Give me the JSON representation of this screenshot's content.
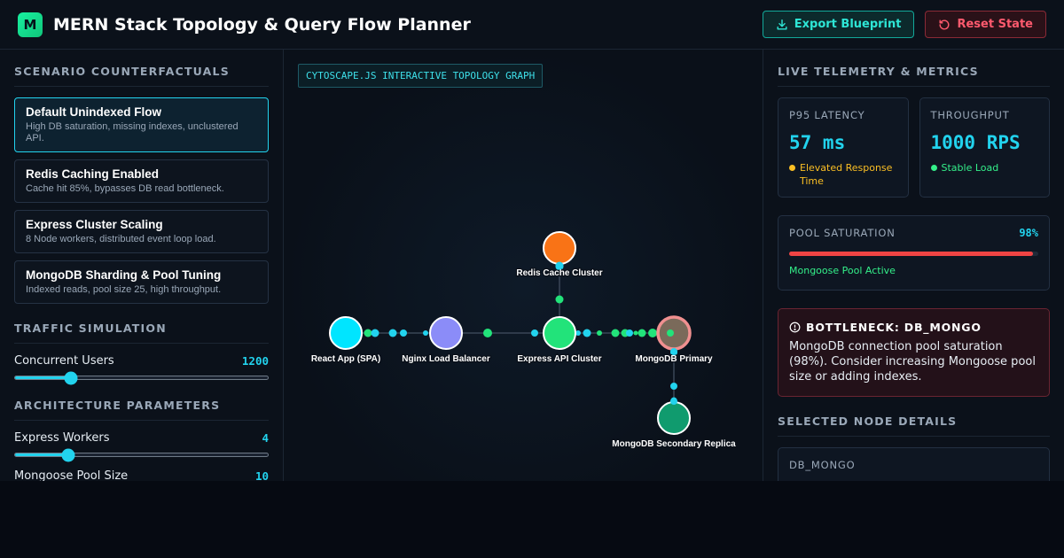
{
  "header": {
    "logo_letter": "M",
    "title": "MERN Stack Topology & Query Flow Planner",
    "export_label": "Export Blueprint",
    "reset_label": "Reset State"
  },
  "scenarios": {
    "title": "SCENARIO COUNTERFACTUALS",
    "items": [
      {
        "name": "Default Unindexed Flow",
        "desc": "High DB saturation, missing indexes, unclustered API.",
        "active": true
      },
      {
        "name": "Redis Caching Enabled",
        "desc": "Cache hit 85%, bypasses DB read bottleneck.",
        "active": false
      },
      {
        "name": "Express Cluster Scaling",
        "desc": "8 Node workers, distributed event loop load.",
        "active": false
      },
      {
        "name": "MongoDB Sharding & Pool Tuning",
        "desc": "Indexed reads, pool size 25, high throughput.",
        "active": false
      }
    ]
  },
  "traffic": {
    "title": "TRAFFIC SIMULATION",
    "users_label": "Concurrent Users",
    "users_value": "1200",
    "users_fraction": 0.22
  },
  "architecture": {
    "title": "ARCHITECTURE PARAMETERS",
    "workers_label": "Express Workers",
    "workers_value": "4",
    "workers_fraction": 0.21,
    "pool_label": "Mongoose Pool Size",
    "pool_value": "10"
  },
  "graph": {
    "tag": "CYTOSCAPE.JS INTERACTIVE TOPOLOGY GRAPH",
    "nodes": {
      "client": "React App (SPA)",
      "nginx": "Nginx Load Balancer",
      "express": "Express API Cluster",
      "redis": "Redis Cache Cluster",
      "mongo_primary": "MongoDB Primary",
      "mongo_secondary": "MongoDB Secondary Replica"
    },
    "colors": {
      "client": "#00e5ff",
      "nginx": "#8b8cf8",
      "express": "#22e37a",
      "redis": "#f97316",
      "mongo_primary": "#7a6a5a",
      "mongo_secondary": "#109b6e"
    }
  },
  "telemetry": {
    "title": "LIVE TELEMETRY & METRICS",
    "latency": {
      "label": "P95 LATENCY",
      "value": "57 ms",
      "status": "Elevated Response Time",
      "color": "#fbbf24"
    },
    "throughput": {
      "label": "THROUGHPUT",
      "value": "1000 RPS",
      "status": "Stable Load",
      "color": "#34f08a"
    },
    "pool": {
      "label": "POOL SATURATION",
      "percent_text": "98%",
      "fraction": 0.98,
      "status": "Mongoose Pool Active"
    }
  },
  "alert": {
    "title": "BOTTLENECK: DB_MONGO",
    "body": "MongoDB connection pool saturation (98%). Consider increasing Mongoose pool size or adding indexes."
  },
  "selected": {
    "title": "SELECTED NODE DETAILS",
    "node_id": "DB_MONGO"
  }
}
